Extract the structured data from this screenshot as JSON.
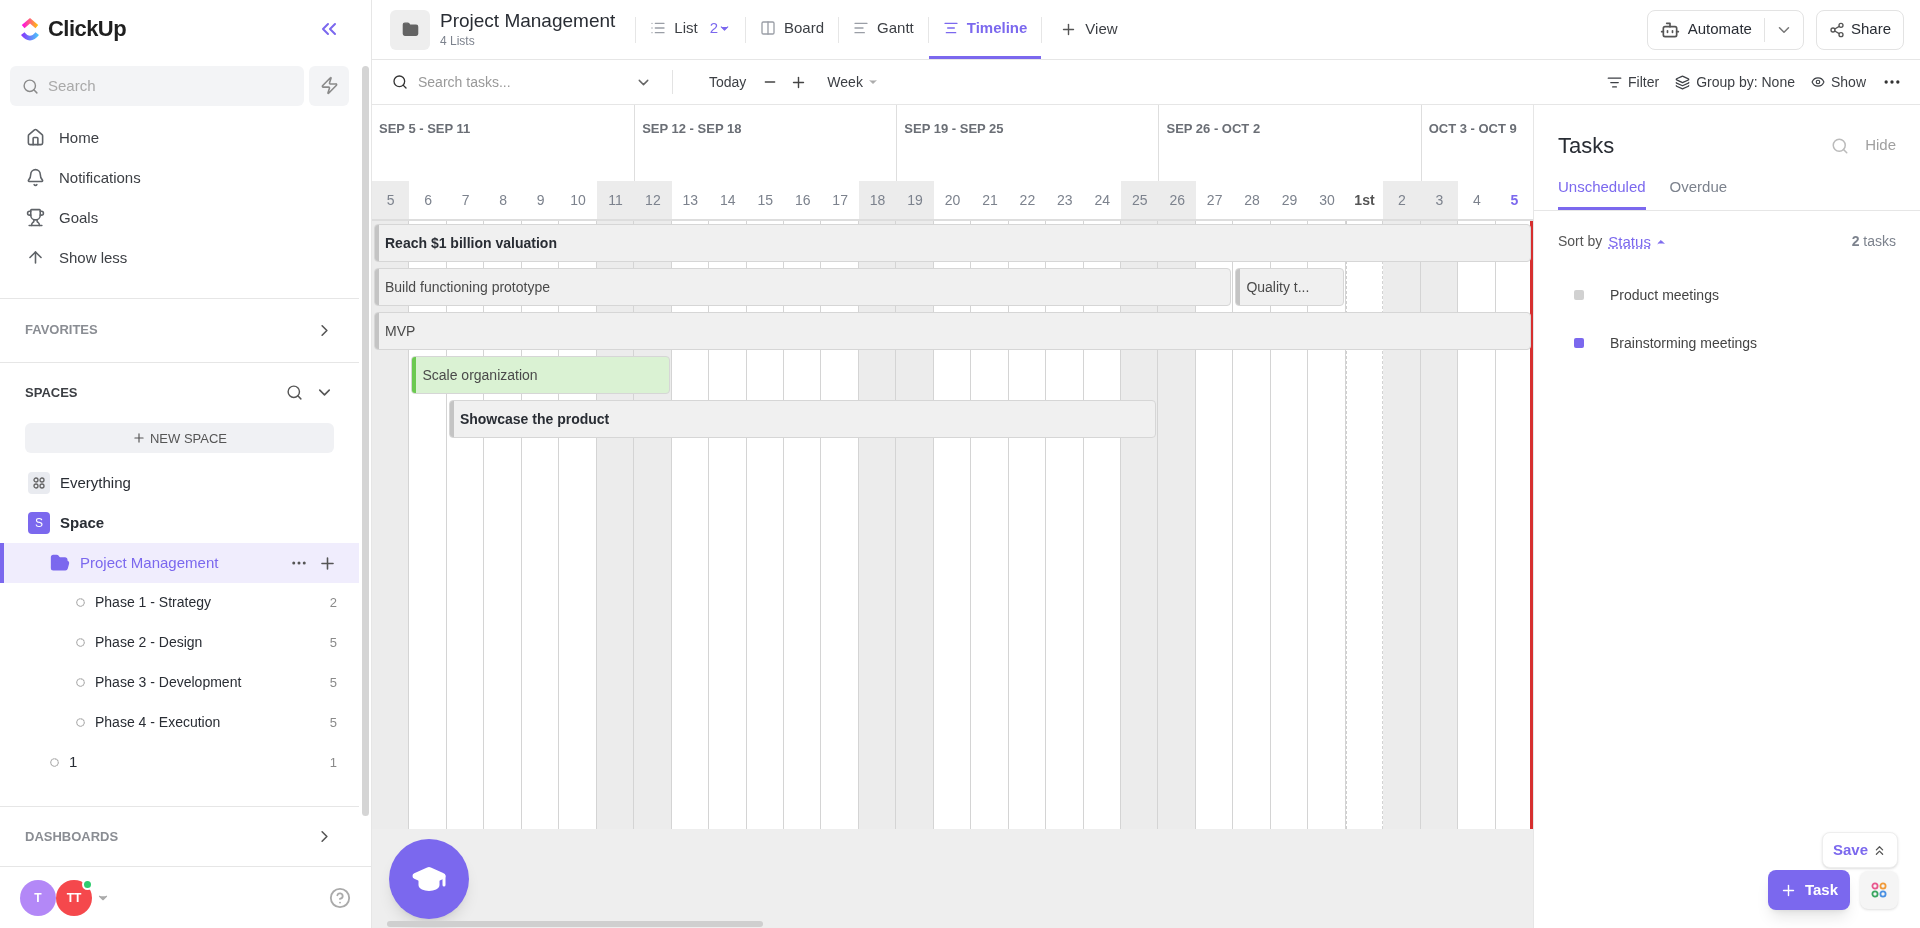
{
  "sidebar": {
    "logo": "ClickUp",
    "search": {
      "placeholder": "Search"
    },
    "nav": [
      {
        "label": "Home"
      },
      {
        "label": "Notifications"
      },
      {
        "label": "Goals"
      },
      {
        "label": "Show less"
      }
    ],
    "favorites": "FAVORITES",
    "spaces_heading": "SPACES",
    "new_space": "NEW SPACE",
    "tree": [
      {
        "kind": "everything",
        "label": "Everything",
        "selected": false
      },
      {
        "kind": "space",
        "label": "Space",
        "badge": "S",
        "selected": false,
        "children": [
          {
            "kind": "folder",
            "label": "Project Management",
            "selected": true,
            "children": [
              {
                "kind": "list",
                "label": "Phase 1 - Strategy",
                "count": "2",
                "selected": false
              },
              {
                "kind": "list",
                "label": "Phase 2 - Design",
                "count": "5",
                "selected": false
              },
              {
                "kind": "list",
                "label": "Phase 3 - Development",
                "count": "5",
                "selected": false
              },
              {
                "kind": "list",
                "label": "Phase 4 - Execution",
                "count": "5",
                "selected": false
              }
            ]
          },
          {
            "kind": "list",
            "label": "1",
            "count": "1",
            "selected": false
          }
        ]
      }
    ],
    "dashboards": "DASHBOARDS",
    "avatars": [
      {
        "initials": "T",
        "color": "#b388f7",
        "online": false
      },
      {
        "initials": "TT",
        "color": "#f5484c",
        "online": true
      }
    ]
  },
  "header": {
    "title": "Project Management",
    "subtitle": "4 Lists",
    "views": [
      {
        "kind": "list",
        "label": "List",
        "badge": "2",
        "selected": false
      },
      {
        "kind": "board",
        "label": "Board",
        "selected": false
      },
      {
        "kind": "gantt",
        "label": "Gantt",
        "selected": false
      },
      {
        "kind": "timeline",
        "label": "Timeline",
        "selected": true
      }
    ],
    "add_view": "View",
    "automate": "Automate",
    "share": "Share"
  },
  "toolbar": {
    "search_placeholder": "Search tasks...",
    "today": "Today",
    "scale": "Week",
    "filter": "Filter",
    "group_by": "Group by: None",
    "show": "Show"
  },
  "timeline": {
    "weeks": [
      {
        "label": "SEP 5 - SEP 11"
      },
      {
        "label": "SEP 12 - SEP 18"
      },
      {
        "label": "SEP 19 - SEP 25"
      },
      {
        "label": "SEP 26 - OCT 2"
      },
      {
        "label": "OCT 3 - OCT 9"
      }
    ],
    "days": [
      {
        "label": "5",
        "weekend": true,
        "today": false,
        "month_start": false
      },
      {
        "label": "6",
        "weekend": false,
        "today": false,
        "month_start": false
      },
      {
        "label": "7",
        "weekend": false,
        "today": false,
        "month_start": false
      },
      {
        "label": "8",
        "weekend": false,
        "today": false,
        "month_start": false
      },
      {
        "label": "9",
        "weekend": false,
        "today": false,
        "month_start": false
      },
      {
        "label": "10",
        "weekend": false,
        "today": false,
        "month_start": false
      },
      {
        "label": "11",
        "weekend": true,
        "today": false,
        "month_start": false
      },
      {
        "label": "12",
        "weekend": true,
        "today": false,
        "month_start": false
      },
      {
        "label": "13",
        "weekend": false,
        "today": false,
        "month_start": false
      },
      {
        "label": "14",
        "weekend": false,
        "today": false,
        "month_start": false
      },
      {
        "label": "15",
        "weekend": false,
        "today": false,
        "month_start": false
      },
      {
        "label": "16",
        "weekend": false,
        "today": false,
        "month_start": false
      },
      {
        "label": "17",
        "weekend": false,
        "today": false,
        "month_start": false
      },
      {
        "label": "18",
        "weekend": true,
        "today": false,
        "month_start": false
      },
      {
        "label": "19",
        "weekend": true,
        "today": false,
        "month_start": false
      },
      {
        "label": "20",
        "weekend": false,
        "today": false,
        "month_start": false
      },
      {
        "label": "21",
        "weekend": false,
        "today": false,
        "month_start": false
      },
      {
        "label": "22",
        "weekend": false,
        "today": false,
        "month_start": false
      },
      {
        "label": "23",
        "weekend": false,
        "today": false,
        "month_start": false
      },
      {
        "label": "24",
        "weekend": false,
        "today": false,
        "month_start": false
      },
      {
        "label": "25",
        "weekend": true,
        "today": false,
        "month_start": false
      },
      {
        "label": "26",
        "weekend": true,
        "today": false,
        "month_start": false
      },
      {
        "label": "27",
        "weekend": false,
        "today": false,
        "month_start": false
      },
      {
        "label": "28",
        "weekend": false,
        "today": false,
        "month_start": false
      },
      {
        "label": "29",
        "weekend": false,
        "today": false,
        "month_start": false
      },
      {
        "label": "30",
        "weekend": false,
        "today": false,
        "month_start": false
      },
      {
        "label": "1st",
        "weekend": false,
        "today": false,
        "month_start": true
      },
      {
        "label": "2",
        "weekend": true,
        "today": false,
        "month_start": false
      },
      {
        "label": "3",
        "weekend": true,
        "today": false,
        "month_start": false
      },
      {
        "label": "4",
        "weekend": false,
        "today": false,
        "month_start": false
      },
      {
        "label": "5",
        "weekend": false,
        "today": true,
        "month_start": false
      }
    ],
    "rows": [
      {
        "bars": [
          {
            "label": "Reach $1 billion valuation",
            "bold": true,
            "color": "#c4c4c4"
          }
        ]
      },
      {
        "bars": [
          {
            "label": "Build functioning prototype",
            "bold": false,
            "color": "#c4c4c4"
          },
          {
            "label": "Quality t...",
            "bold": false,
            "color": "#c4c4c4"
          }
        ]
      },
      {
        "bars": [
          {
            "label": "MVP",
            "bold": false,
            "color": "#c4c4c4"
          }
        ]
      },
      {
        "bars": [
          {
            "label": "Scale organization",
            "bold": false,
            "color": "#6bc950"
          }
        ]
      },
      {
        "bars": [
          {
            "label": "Showcase the product",
            "bold": true,
            "color": "#c4c4c4"
          }
        ]
      }
    ]
  },
  "tasks_panel": {
    "title": "Tasks",
    "hide": "Hide",
    "tabs": [
      {
        "label": "Unscheduled",
        "selected": true
      },
      {
        "label": "Overdue",
        "selected": false
      }
    ],
    "sort_label": "Sort by",
    "sort_field": "Status",
    "count": "**2** tasks",
    "items": [
      {
        "label": "Product meetings",
        "color": "#d1d1d1"
      },
      {
        "label": "Brainstorming meetings",
        "color": "#7b68ee"
      }
    ],
    "save": "Save",
    "new_task": "Task"
  }
}
